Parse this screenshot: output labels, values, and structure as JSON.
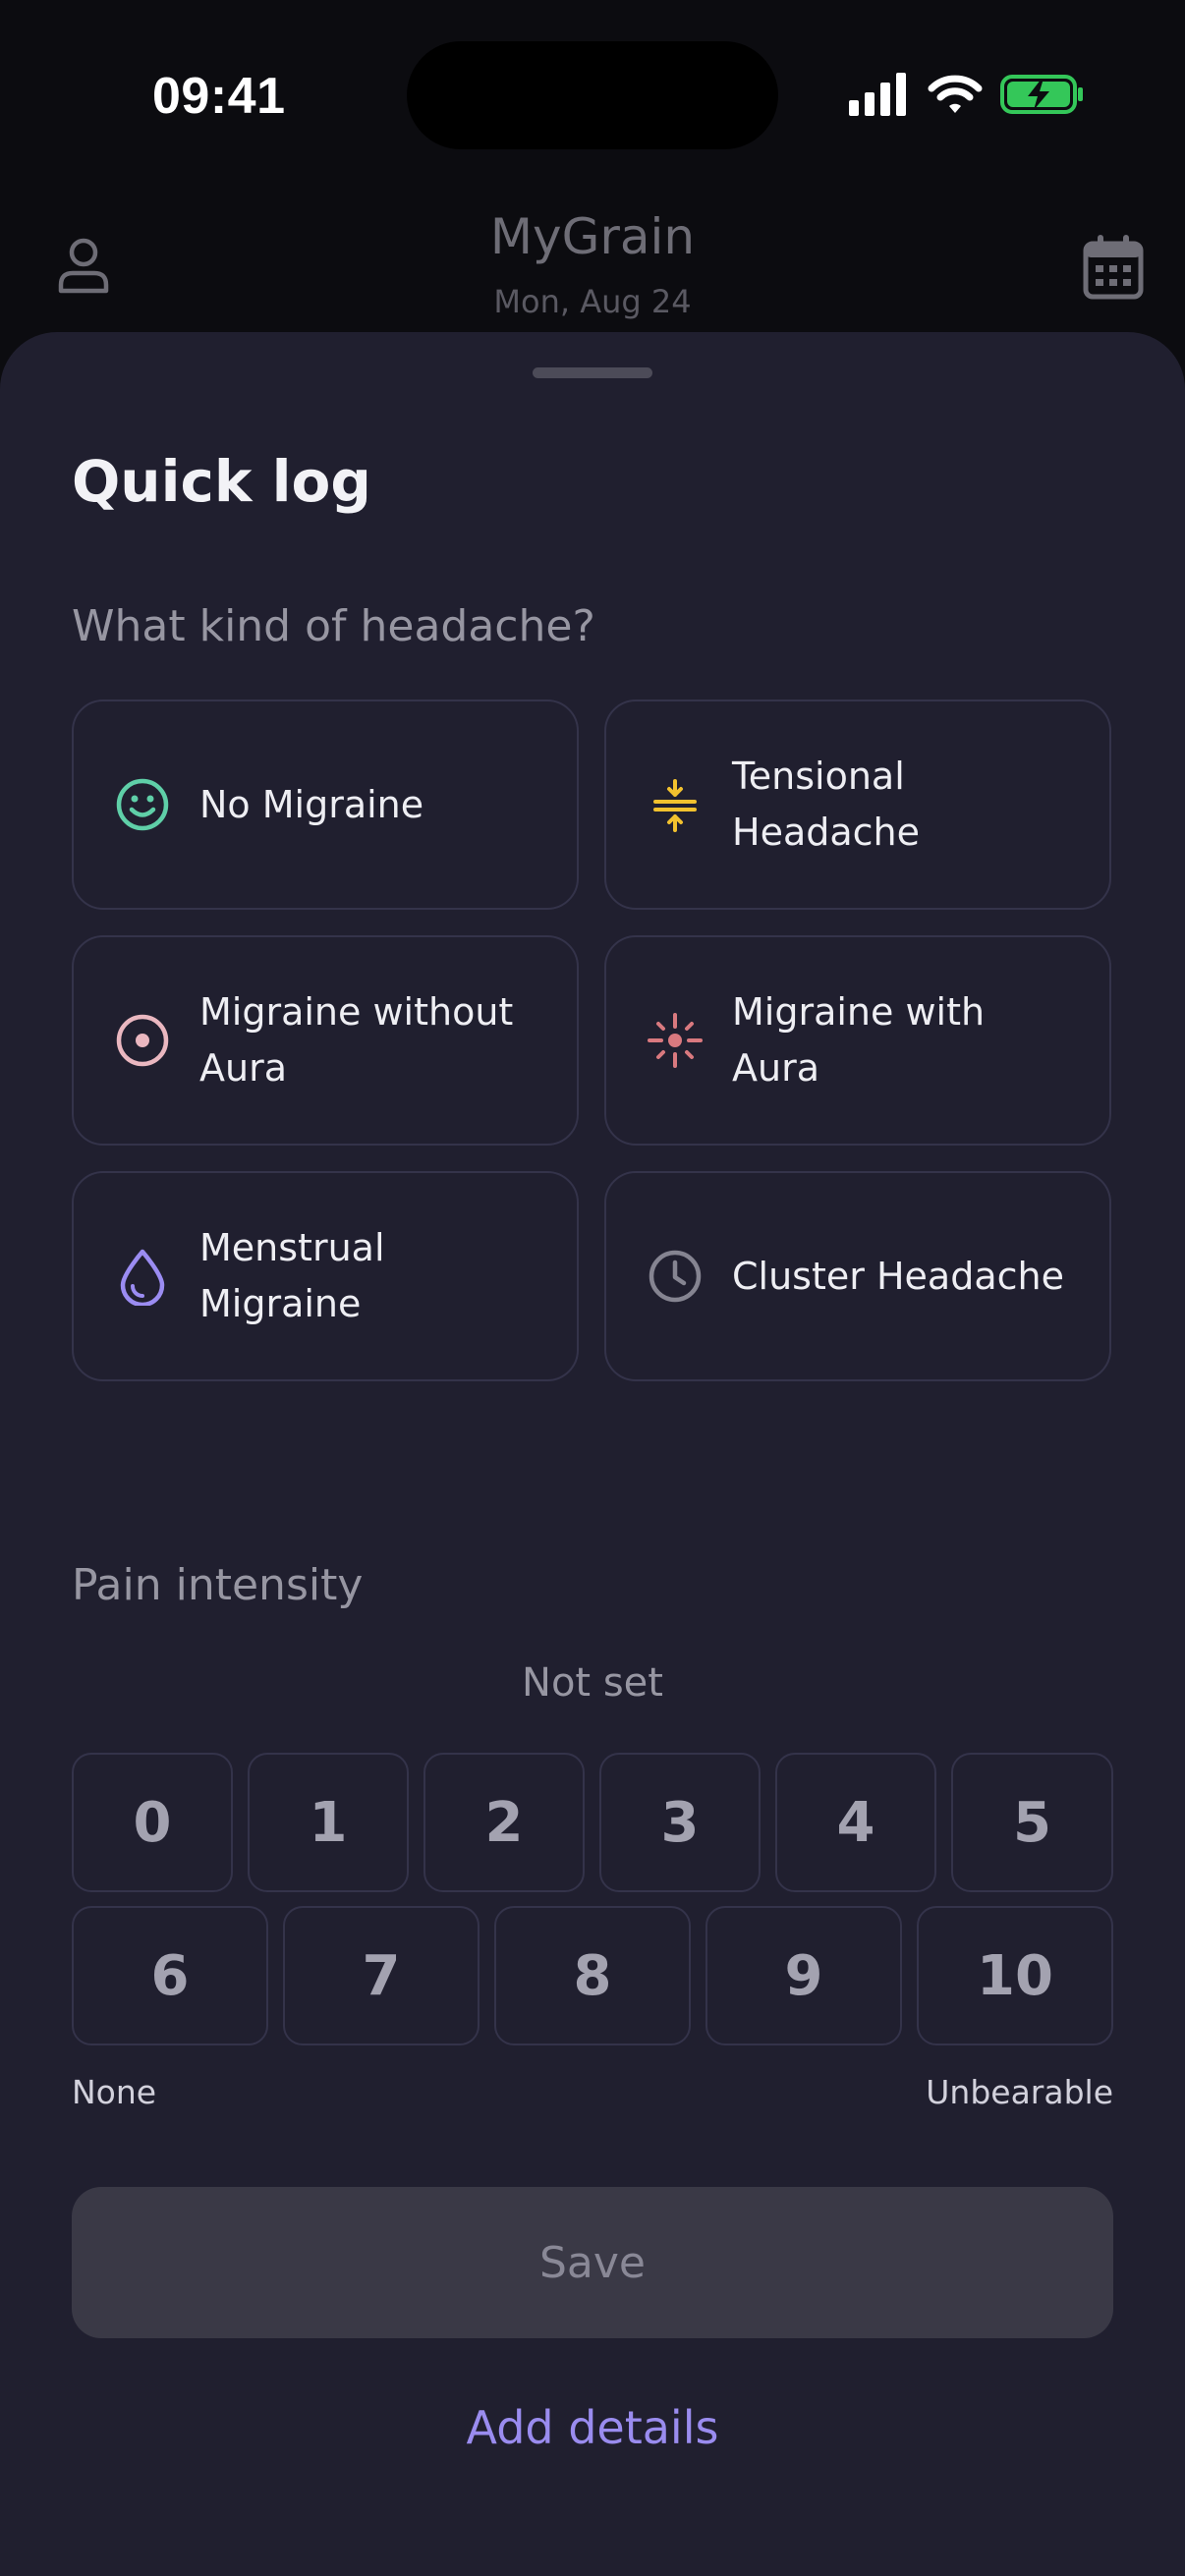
{
  "status_bar": {
    "time": "09:41"
  },
  "header": {
    "title": "MyGrain",
    "date": "Mon, Aug 24"
  },
  "sheet": {
    "title": "Quick log",
    "headache_question": "What kind of headache?",
    "headache_types": [
      {
        "label": "No Migraine",
        "icon": "smile-icon",
        "color": "#5fcfa8"
      },
      {
        "label": "Tensional Headache",
        "icon": "compress-icon",
        "color": "#f2c12e"
      },
      {
        "label": "Migraine without Aura",
        "icon": "target-icon",
        "color": "#eab7c0"
      },
      {
        "label": "Migraine with Aura",
        "icon": "aura-burst-icon",
        "color": "#d9797f"
      },
      {
        "label": "Menstrual Migraine",
        "icon": "droplet-icon",
        "color": "#9b8cf2"
      },
      {
        "label": "Cluster Headache",
        "icon": "clock-icon",
        "color": "#858491"
      }
    ],
    "intensity_label": "Pain intensity",
    "intensity_status": "Not set",
    "intensity_levels": [
      "0",
      "1",
      "2",
      "3",
      "4",
      "5",
      "6",
      "7",
      "8",
      "9",
      "10"
    ],
    "scale_min_label": "None",
    "scale_max_label": "Unbearable",
    "save_label": "Save",
    "add_details_label": "Add details"
  }
}
